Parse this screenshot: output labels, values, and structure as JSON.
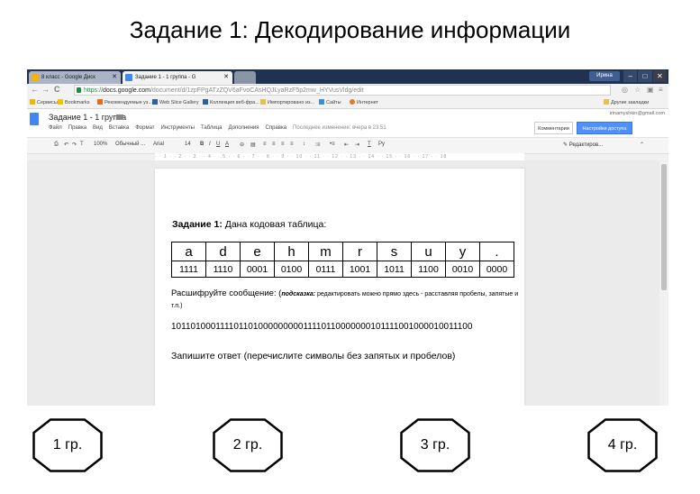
{
  "title": "Задание 1: Декодирование информации",
  "browser": {
    "tabs": [
      {
        "label": "8 класс - Google Диск"
      },
      {
        "label": "Задание 1 - 1 группа - G"
      },
      {
        "label": ""
      }
    ],
    "user": "Ирина",
    "url_scheme": "https://",
    "url_host": "docs.google.com",
    "url_path": "/document/d/1zpFPgATzZQV6aFvoCAsHQJLyaRzF5p2mw_HYVusVldg/edit",
    "bookmarks": [
      "Сервисы",
      "Bookmarks",
      "Рекомендуемые уз...",
      "Web Slice Gallery",
      "Коллекция веб-фра...",
      "Импортировано из...",
      "Сайты",
      "Интернет"
    ],
    "other_bookmarks": "Другие закладки"
  },
  "docs": {
    "doc_title": "Задание 1 - 1 группа",
    "menus": [
      "Файл",
      "Правка",
      "Вид",
      "Вставка",
      "Формат",
      "Инструменты",
      "Таблица",
      "Дополнения",
      "Справка"
    ],
    "last_edit": "Последнее изменение: вчера в 23:51",
    "email": "irinamyshkin@gmail.com",
    "comments_label": "Комментарии",
    "share_label": "Настройки доступа",
    "zoom": "100%",
    "style": "Обычный ...",
    "font": "Arial",
    "font_size": "14",
    "editing_mode": "Редактиров..."
  },
  "document": {
    "task_bold": "Задание 1:",
    "task_text": " Дана кодовая таблица:",
    "letters": [
      "a",
      "d",
      "e",
      "h",
      "m",
      "r",
      "s",
      "u",
      "y",
      "."
    ],
    "codes": [
      "1111",
      "1110",
      "0001",
      "0100",
      "0111",
      "1001",
      "1011",
      "1100",
      "0010",
      "0000"
    ],
    "decode_text": "Расшифруйте сообщение: (",
    "hint_bold": "подсказка:",
    "hint_text": " редактировать можно прямо здесь - расставляя пробелы, запятые и т.п.)",
    "message": "10110100011110110100000000011110110000000101111001000010011100",
    "answer_prompt": "Запишите ответ (перечислите символы без запятых и пробелов)"
  },
  "groups": [
    "1 гр.",
    "2 гр.",
    "3 гр.",
    "4 гр."
  ]
}
